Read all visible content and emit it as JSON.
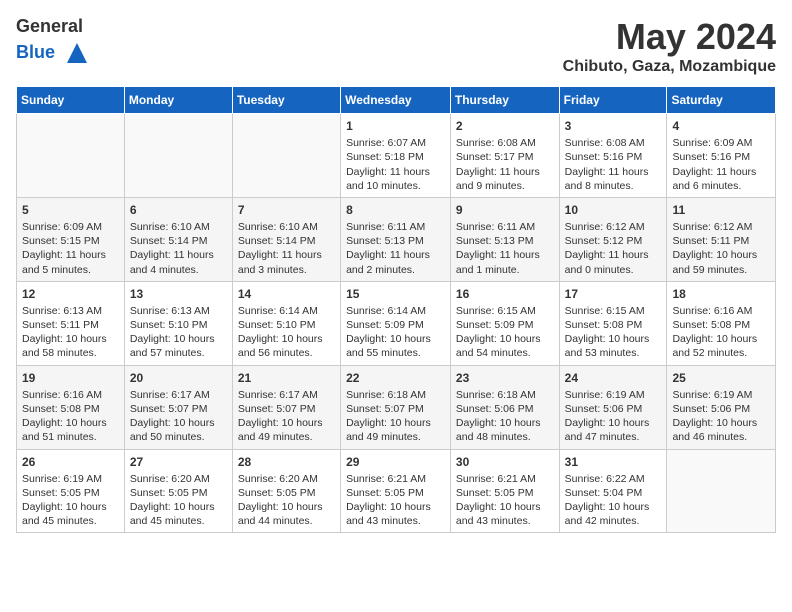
{
  "logo": {
    "line1": "General",
    "line2": "Blue"
  },
  "title": "May 2024",
  "location": "Chibuto, Gaza, Mozambique",
  "headers": [
    "Sunday",
    "Monday",
    "Tuesday",
    "Wednesday",
    "Thursday",
    "Friday",
    "Saturday"
  ],
  "weeks": [
    [
      {
        "day": "",
        "info": ""
      },
      {
        "day": "",
        "info": ""
      },
      {
        "day": "",
        "info": ""
      },
      {
        "day": "1",
        "info": "Sunrise: 6:07 AM\nSunset: 5:18 PM\nDaylight: 11 hours\nand 10 minutes."
      },
      {
        "day": "2",
        "info": "Sunrise: 6:08 AM\nSunset: 5:17 PM\nDaylight: 11 hours\nand 9 minutes."
      },
      {
        "day": "3",
        "info": "Sunrise: 6:08 AM\nSunset: 5:16 PM\nDaylight: 11 hours\nand 8 minutes."
      },
      {
        "day": "4",
        "info": "Sunrise: 6:09 AM\nSunset: 5:16 PM\nDaylight: 11 hours\nand 6 minutes."
      }
    ],
    [
      {
        "day": "5",
        "info": "Sunrise: 6:09 AM\nSunset: 5:15 PM\nDaylight: 11 hours\nand 5 minutes."
      },
      {
        "day": "6",
        "info": "Sunrise: 6:10 AM\nSunset: 5:14 PM\nDaylight: 11 hours\nand 4 minutes."
      },
      {
        "day": "7",
        "info": "Sunrise: 6:10 AM\nSunset: 5:14 PM\nDaylight: 11 hours\nand 3 minutes."
      },
      {
        "day": "8",
        "info": "Sunrise: 6:11 AM\nSunset: 5:13 PM\nDaylight: 11 hours\nand 2 minutes."
      },
      {
        "day": "9",
        "info": "Sunrise: 6:11 AM\nSunset: 5:13 PM\nDaylight: 11 hours\nand 1 minute."
      },
      {
        "day": "10",
        "info": "Sunrise: 6:12 AM\nSunset: 5:12 PM\nDaylight: 11 hours\nand 0 minutes."
      },
      {
        "day": "11",
        "info": "Sunrise: 6:12 AM\nSunset: 5:11 PM\nDaylight: 10 hours\nand 59 minutes."
      }
    ],
    [
      {
        "day": "12",
        "info": "Sunrise: 6:13 AM\nSunset: 5:11 PM\nDaylight: 10 hours\nand 58 minutes."
      },
      {
        "day": "13",
        "info": "Sunrise: 6:13 AM\nSunset: 5:10 PM\nDaylight: 10 hours\nand 57 minutes."
      },
      {
        "day": "14",
        "info": "Sunrise: 6:14 AM\nSunset: 5:10 PM\nDaylight: 10 hours\nand 56 minutes."
      },
      {
        "day": "15",
        "info": "Sunrise: 6:14 AM\nSunset: 5:09 PM\nDaylight: 10 hours\nand 55 minutes."
      },
      {
        "day": "16",
        "info": "Sunrise: 6:15 AM\nSunset: 5:09 PM\nDaylight: 10 hours\nand 54 minutes."
      },
      {
        "day": "17",
        "info": "Sunrise: 6:15 AM\nSunset: 5:08 PM\nDaylight: 10 hours\nand 53 minutes."
      },
      {
        "day": "18",
        "info": "Sunrise: 6:16 AM\nSunset: 5:08 PM\nDaylight: 10 hours\nand 52 minutes."
      }
    ],
    [
      {
        "day": "19",
        "info": "Sunrise: 6:16 AM\nSunset: 5:08 PM\nDaylight: 10 hours\nand 51 minutes."
      },
      {
        "day": "20",
        "info": "Sunrise: 6:17 AM\nSunset: 5:07 PM\nDaylight: 10 hours\nand 50 minutes."
      },
      {
        "day": "21",
        "info": "Sunrise: 6:17 AM\nSunset: 5:07 PM\nDaylight: 10 hours\nand 49 minutes."
      },
      {
        "day": "22",
        "info": "Sunrise: 6:18 AM\nSunset: 5:07 PM\nDaylight: 10 hours\nand 49 minutes."
      },
      {
        "day": "23",
        "info": "Sunrise: 6:18 AM\nSunset: 5:06 PM\nDaylight: 10 hours\nand 48 minutes."
      },
      {
        "day": "24",
        "info": "Sunrise: 6:19 AM\nSunset: 5:06 PM\nDaylight: 10 hours\nand 47 minutes."
      },
      {
        "day": "25",
        "info": "Sunrise: 6:19 AM\nSunset: 5:06 PM\nDaylight: 10 hours\nand 46 minutes."
      }
    ],
    [
      {
        "day": "26",
        "info": "Sunrise: 6:19 AM\nSunset: 5:05 PM\nDaylight: 10 hours\nand 45 minutes."
      },
      {
        "day": "27",
        "info": "Sunrise: 6:20 AM\nSunset: 5:05 PM\nDaylight: 10 hours\nand 45 minutes."
      },
      {
        "day": "28",
        "info": "Sunrise: 6:20 AM\nSunset: 5:05 PM\nDaylight: 10 hours\nand 44 minutes."
      },
      {
        "day": "29",
        "info": "Sunrise: 6:21 AM\nSunset: 5:05 PM\nDaylight: 10 hours\nand 43 minutes."
      },
      {
        "day": "30",
        "info": "Sunrise: 6:21 AM\nSunset: 5:05 PM\nDaylight: 10 hours\nand 43 minutes."
      },
      {
        "day": "31",
        "info": "Sunrise: 6:22 AM\nSunset: 5:04 PM\nDaylight: 10 hours\nand 42 minutes."
      },
      {
        "day": "",
        "info": ""
      }
    ]
  ]
}
